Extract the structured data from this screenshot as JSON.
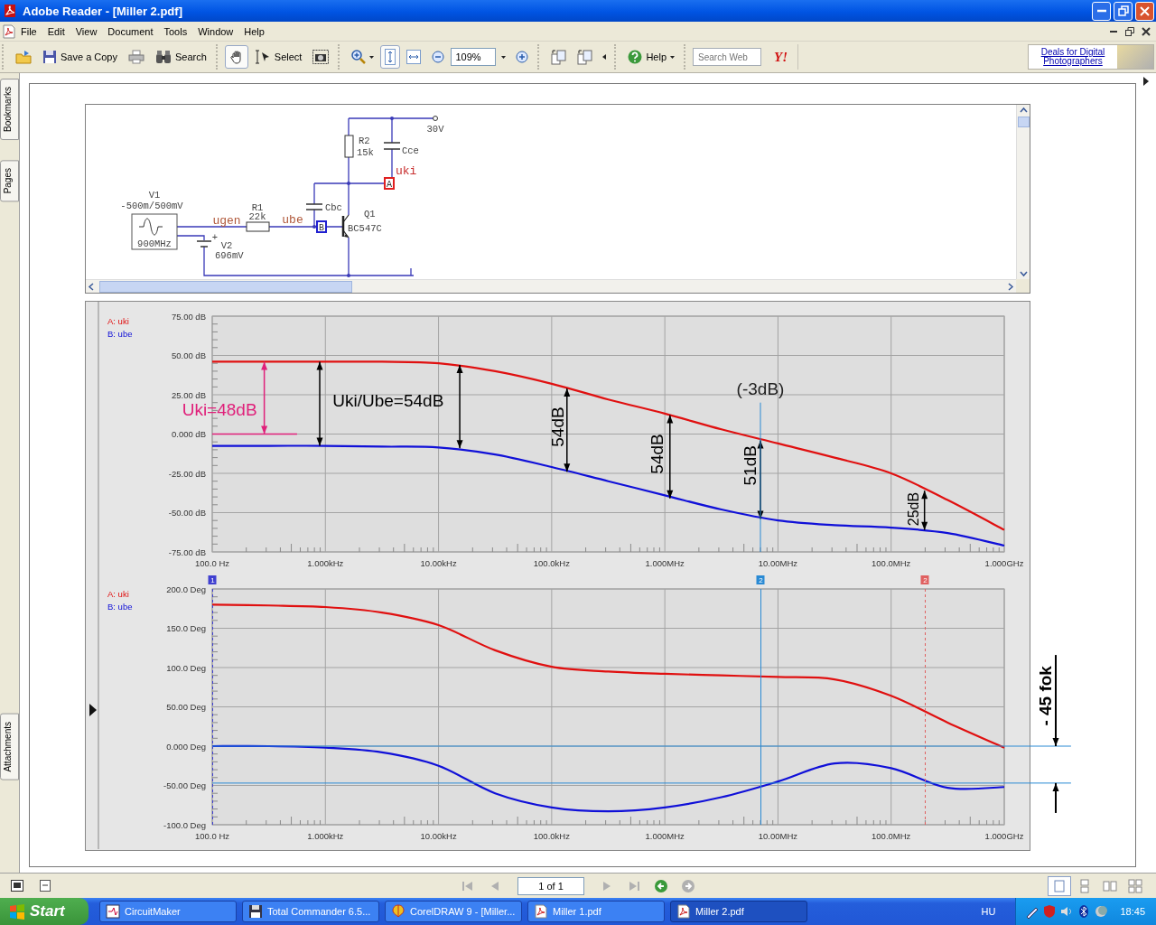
{
  "window": {
    "title": "Adobe Reader - [Miller 2.pdf]"
  },
  "menu": [
    "File",
    "Edit",
    "View",
    "Document",
    "Tools",
    "Window",
    "Help"
  ],
  "toolbar_groups": [
    [
      {
        "kind": "open",
        "selected": false
      },
      {
        "kind": "save",
        "label": "Save a Copy",
        "selected": false
      },
      {
        "kind": "print",
        "selected": false
      },
      {
        "kind": "search",
        "label": "Search",
        "selected": false
      }
    ],
    [
      {
        "kind": "hand",
        "selected": true
      },
      {
        "kind": "select",
        "label": "Select",
        "selected": false
      },
      {
        "kind": "snapshot",
        "selected": false
      }
    ],
    [
      {
        "kind": "zoomin",
        "selected": false
      },
      {
        "kind": "fitpage",
        "selected": true
      },
      {
        "kind": "fitwidth",
        "selected": false
      },
      {
        "kind": "zoomout",
        "selected": false
      },
      {
        "kind": "zoomfield",
        "value": "109%"
      },
      {
        "kind": "zoomplus",
        "selected": false
      }
    ],
    [
      {
        "kind": "rotatecw",
        "selected": false
      },
      {
        "kind": "rotateccw",
        "selected": false
      },
      {
        "kind": "more"
      }
    ],
    [
      {
        "kind": "help",
        "label": "Help",
        "selected": false
      }
    ],
    [
      {
        "kind": "searchweb",
        "placeholder": "Search Web"
      },
      {
        "kind": "yahoo",
        "label": "Y!"
      }
    ]
  ],
  "ad": {
    "text": "Deals for Digital Photographers"
  },
  "side_tabs": {
    "top": [
      {
        "label": "Bookmarks"
      },
      {
        "label": "Pages"
      }
    ],
    "bottom": [
      {
        "label": "Attachments"
      }
    ]
  },
  "schematic": {
    "labels": [
      {
        "text": "30V",
        "kind": "part"
      },
      {
        "text": "R2",
        "kind": "part"
      },
      {
        "text": "15k",
        "kind": "part"
      },
      {
        "text": "Cce",
        "kind": "part"
      },
      {
        "text": "uki",
        "kind": "net",
        "color": "#c83030"
      },
      {
        "text": "A",
        "kind": "marker",
        "color": "#e02020"
      },
      {
        "text": "V1",
        "kind": "part"
      },
      {
        "text": "-500m/500mV",
        "kind": "part"
      },
      {
        "text": "R1",
        "kind": "part"
      },
      {
        "text": "Cbc",
        "kind": "part"
      },
      {
        "text": "22k",
        "kind": "part"
      },
      {
        "text": "Q1",
        "kind": "part"
      },
      {
        "text": "ugen",
        "kind": "net",
        "color": "#b0583a"
      },
      {
        "text": "ube",
        "kind": "net",
        "color": "#b0583a"
      },
      {
        "text": "B",
        "kind": "marker",
        "color": "#2020d0"
      },
      {
        "text": "BC547C",
        "kind": "part"
      },
      {
        "text": "+",
        "kind": "part"
      },
      {
        "text": "900MHz",
        "kind": "part"
      },
      {
        "text": "V2",
        "kind": "part"
      },
      {
        "text": "696mV",
        "kind": "part"
      }
    ]
  },
  "magnitude": {
    "chart_data": {
      "type": "line",
      "grid": true,
      "ylim": [
        -75,
        75
      ],
      "categories": [
        "100.0 Hz",
        null,
        "1.000kHz",
        null,
        "10.00kHz",
        null,
        "100.0kHz",
        null,
        "1.000MHz",
        null,
        "10.00MHz",
        null,
        "100.0MHz",
        null,
        "1.000GHz"
      ],
      "series": [
        {
          "name": "A: uki",
          "color": "#e01010",
          "values": [
            46,
            46,
            46,
            46,
            45,
            40,
            32,
            22,
            13,
            3,
            -6,
            -15,
            -25,
            -42,
            -61
          ]
        },
        {
          "name": "B: ube",
          "color": "#1010d8",
          "values": [
            -7.5,
            -7.5,
            -7.5,
            -8,
            -8.5,
            -13,
            -21,
            -30,
            -39,
            -48,
            -55,
            -58,
            -59.5,
            -63,
            -71
          ]
        }
      ],
      "yticks": [
        {
          "value": 75,
          "label": "75.00 dB"
        },
        {
          "value": 50,
          "label": "50.00 dB"
        },
        {
          "value": 25,
          "label": "25.00 dB"
        },
        {
          "value": 0,
          "label": "0.000 dB"
        },
        {
          "value": -25,
          "label": "-25.00 dB"
        },
        {
          "value": -50,
          "label": "-50.00 dB"
        },
        {
          "value": -75,
          "label": "-75.00 dB"
        }
      ],
      "annotations": [
        "Uki=48dB",
        "Uki/Ube=54dB",
        "54dB",
        "54dB",
        "51dB",
        "(-3dB)",
        "25dB"
      ]
    }
  },
  "phase": {
    "cursors": [
      {
        "label": "1",
        "color": "#4040d0",
        "dashed": true
      },
      {
        "label": "2",
        "color": "#2a8ad4",
        "dashed": false
      },
      {
        "label": "2",
        "color": "#e06060",
        "dashed": true
      }
    ],
    "chart_data": {
      "type": "line",
      "grid": true,
      "ylim": [
        -100,
        200
      ],
      "categories": [
        "100.0 Hz",
        null,
        "1.000kHz",
        null,
        "10.00kHz",
        null,
        "100.0kHz",
        null,
        "1.000MHz",
        null,
        "10.00MHz",
        null,
        "100.0MHz",
        null,
        "1.000GHz"
      ],
      "series": [
        {
          "name": "A: uki",
          "color": "#e01010",
          "values": [
            180,
            179,
            177,
            170,
            154,
            122,
            101,
            95,
            92,
            90,
            88,
            85,
            64,
            30,
            -2
          ]
        },
        {
          "name": "B: ube",
          "color": "#1010d8",
          "values": [
            0,
            0,
            -2,
            -8,
            -25,
            -60,
            -78,
            -83,
            -78,
            -65,
            -45,
            -22,
            -28,
            -53,
            -52
          ]
        }
      ],
      "yticks": [
        {
          "value": 200,
          "label": "200.0 Deg"
        },
        {
          "value": 150,
          "label": "150.0 Deg"
        },
        {
          "value": 100,
          "label": "100.0 Deg"
        },
        {
          "value": 50,
          "label": "50.00 Deg"
        },
        {
          "value": 0,
          "label": "0.000 Deg"
        },
        {
          "value": -50,
          "label": "-50.00 Deg"
        },
        {
          "value": -100,
          "label": "-100.0 Deg"
        }
      ],
      "annotations": [
        "- 45 fok"
      ]
    }
  },
  "status_bar": {
    "nav": [
      {
        "kind": "first",
        "disabled": true
      },
      {
        "kind": "prev",
        "disabled": true
      },
      {
        "kind": "page",
        "value": "1 of 1"
      },
      {
        "kind": "next",
        "disabled": true
      },
      {
        "kind": "last",
        "disabled": true
      },
      {
        "kind": "back",
        "disabled": false
      },
      {
        "kind": "forward",
        "disabled": true
      }
    ],
    "views": [
      {
        "kind": "single",
        "selected": true
      },
      {
        "kind": "continuous",
        "selected": false
      },
      {
        "kind": "facing",
        "selected": false
      },
      {
        "kind": "continuous-facing",
        "selected": false
      }
    ]
  },
  "taskbar": {
    "start": "Start",
    "tasks": [
      {
        "kind": "circuit",
        "label": "CircuitMaker",
        "selected": false
      },
      {
        "kind": "floppy",
        "label": "Total Commander 6.5...",
        "selected": false
      },
      {
        "kind": "balloon",
        "label": "CorelDRAW 9 - [Miller...",
        "selected": false
      },
      {
        "kind": "pdf",
        "label": "Miller 1.pdf",
        "selected": false
      },
      {
        "kind": "pdf",
        "label": "Miller 2.pdf",
        "selected": true
      }
    ],
    "language": "HU",
    "clock": "18:45"
  }
}
